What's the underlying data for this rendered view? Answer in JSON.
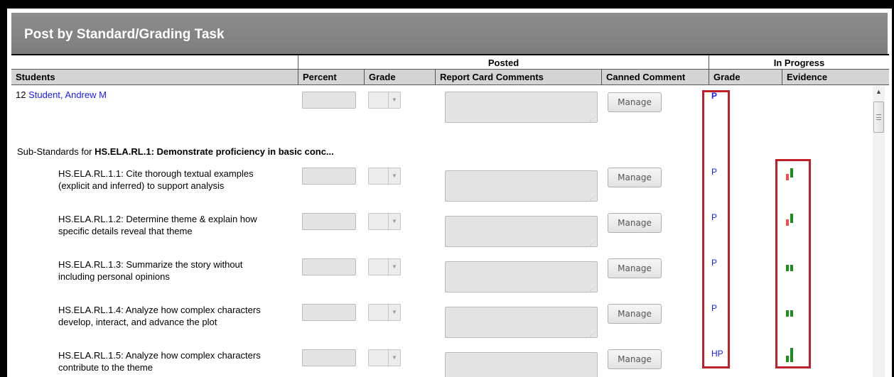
{
  "panel": {
    "title": "Post by Standard/Grading Task"
  },
  "group_headers": {
    "posted": "Posted",
    "in_progress": "In Progress"
  },
  "columns": {
    "students": "Students",
    "percent": "Percent",
    "grade": "Grade",
    "report_card_comments": "Report Card Comments",
    "canned_comment": "Canned Comment",
    "ip_grade": "Grade",
    "evidence": "Evidence"
  },
  "student": {
    "number": "12",
    "name": "Student, Andrew M",
    "ip_grade": "P",
    "manage_label": "Manage"
  },
  "sub_header": {
    "prefix": "Sub-Standards for ",
    "standard": "HS.ELA.RL.1: Demonstrate proficiency in basic conc..."
  },
  "standards": [
    {
      "line1": "HS.ELA.RL.1.1: Cite thorough textual examples",
      "line2": "(explicit and inferred) to support analysis",
      "ip_grade": "P",
      "manage_label": "Manage",
      "evidence": [
        {
          "level": 0.45,
          "color": "#f05050"
        },
        {
          "level": 0.65,
          "color": "#1c8c1c"
        }
      ]
    },
    {
      "line1": "HS.ELA.RL.1.2: Determine theme & explain how",
      "line2": "specific details reveal that theme",
      "ip_grade": "P",
      "manage_label": "Manage",
      "evidence": [
        {
          "level": 0.45,
          "color": "#f05050"
        },
        {
          "level": 0.65,
          "color": "#1c8c1c"
        }
      ]
    },
    {
      "line1": "HS.ELA.RL.1.3: Summarize the story without",
      "line2": "including personal opinions",
      "ip_grade": "P",
      "manage_label": "Manage",
      "evidence": [
        {
          "level": 0.45,
          "color": "#1c8c1c"
        },
        {
          "level": 0.45,
          "color": "#1c8c1c"
        }
      ]
    },
    {
      "line1": "HS.ELA.RL.1.4: Analyze how complex characters",
      "line2": "develop, interact, and advance the plot",
      "ip_grade": "P",
      "manage_label": "Manage",
      "evidence": [
        {
          "level": 0.45,
          "color": "#1c8c1c"
        },
        {
          "level": 0.45,
          "color": "#1c8c1c"
        }
      ]
    },
    {
      "line1": "HS.ELA.RL.1.5: Analyze how complex characters",
      "line2": "contribute to the theme",
      "ip_grade": "HP",
      "manage_label": "Manage",
      "evidence": [
        {
          "level": 0.45,
          "color": "#1c8c1c"
        },
        {
          "level": 1.0,
          "color": "#1c8c1c"
        }
      ]
    }
  ],
  "icons": {
    "dropdown": "chevron-down-icon",
    "scroll_up": "arrow-up-icon",
    "scroll_grip": "grip-icon"
  },
  "colors": {
    "link": "#1a1aff",
    "highlight": "#c0202a",
    "evidence_good": "#1c8c1c",
    "evidence_low": "#f05050"
  }
}
